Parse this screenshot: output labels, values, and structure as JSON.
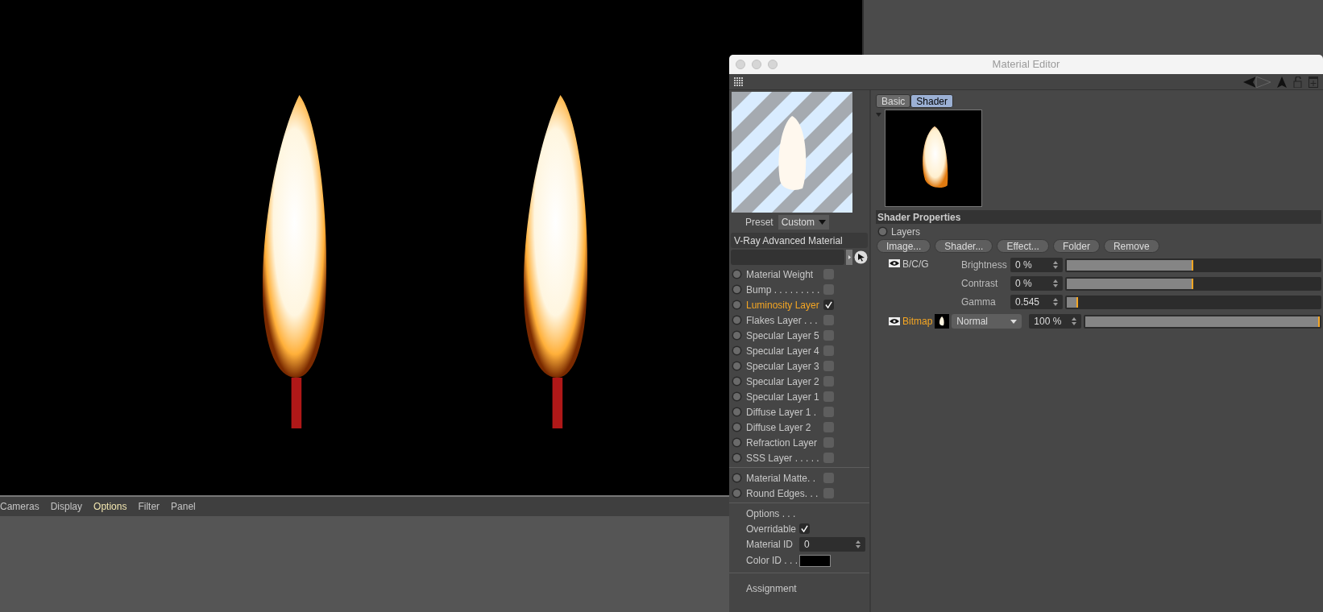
{
  "viewport": {
    "menu": [
      {
        "label": "Cameras",
        "selected": false
      },
      {
        "label": "Display",
        "selected": false
      },
      {
        "label": "Options",
        "selected": true
      },
      {
        "label": "Filter",
        "selected": false
      },
      {
        "label": "Panel",
        "selected": false
      }
    ]
  },
  "material_editor": {
    "title": "Material Editor",
    "preset": {
      "label": "Preset",
      "value": "Custom"
    },
    "material_name": "V-Ray Advanced Material",
    "layer_groups": [
      [
        {
          "label": "Material Weight",
          "checked": false,
          "selected": false
        },
        {
          "label": "Bump . . . . . . . . .",
          "checked": false,
          "selected": false
        },
        {
          "label": "Luminosity Layer",
          "checked": true,
          "selected": true
        },
        {
          "label": "Flakes Layer . . .",
          "checked": false,
          "selected": false
        },
        {
          "label": "Specular Layer 5",
          "checked": false,
          "selected": false
        },
        {
          "label": "Specular Layer 4",
          "checked": false,
          "selected": false
        },
        {
          "label": "Specular Layer 3",
          "checked": false,
          "selected": false
        },
        {
          "label": "Specular Layer 2",
          "checked": false,
          "selected": false
        },
        {
          "label": "Specular Layer 1",
          "checked": false,
          "selected": false
        },
        {
          "label": "Diffuse Layer 1 .",
          "checked": false,
          "selected": false
        },
        {
          "label": "Diffuse Layer 2",
          "checked": false,
          "selected": false
        },
        {
          "label": "Refraction Layer",
          "checked": false,
          "selected": false
        },
        {
          "label": "SSS Layer . . . . .",
          "checked": false,
          "selected": false
        }
      ],
      [
        {
          "label": "Material Matte. .",
          "checked": false,
          "selected": false
        },
        {
          "label": "Round Edges. . .",
          "checked": false,
          "selected": false
        }
      ]
    ],
    "options": {
      "title": "Options . . .",
      "overridable": {
        "label": "Overridable",
        "checked": true
      },
      "material_id": {
        "label": "Material ID",
        "value": "0"
      },
      "color_id": {
        "label": "Color ID . . .",
        "color": "#000000"
      }
    },
    "assignment": "Assignment",
    "tabs": [
      {
        "label": "Basic",
        "selected": false
      },
      {
        "label": "Shader",
        "selected": true
      }
    ],
    "section_title": "Shader Properties",
    "layers_label": "Layers",
    "buttons": [
      "Image...",
      "Shader...",
      "Effect...",
      "Folder",
      "Remove"
    ],
    "bcg": {
      "name": "B/C/G",
      "params": [
        {
          "label": "Brightness",
          "value": "0 %",
          "level": 0.5
        },
        {
          "label": "Contrast",
          "value": "0 %",
          "level": 0.5
        },
        {
          "label": "Gamma",
          "value": "0.545",
          "level": 0.045
        }
      ]
    },
    "bitmap": {
      "name": "Bitmap",
      "blend": "Normal",
      "value": "100 %",
      "level": 1
    }
  }
}
